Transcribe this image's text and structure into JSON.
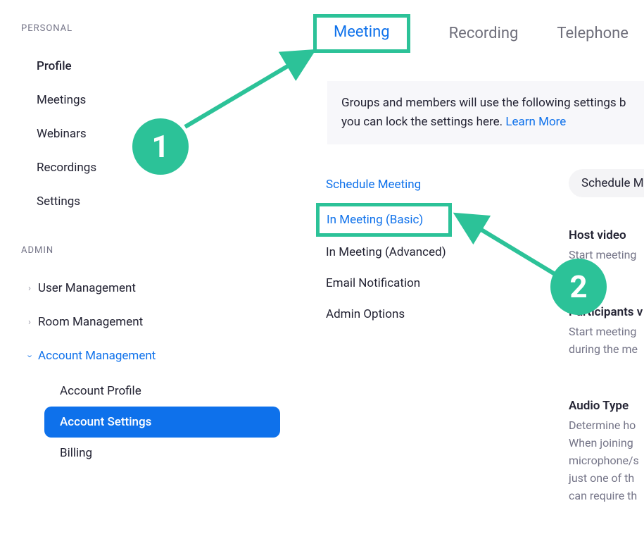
{
  "sidebar": {
    "personal_header": "PERSONAL",
    "personal_items": [
      "Profile",
      "Meetings",
      "Webinars",
      "Recordings",
      "Settings"
    ],
    "admin_header": "ADMIN",
    "admin_items": [
      {
        "label": "User Management",
        "expanded": false
      },
      {
        "label": "Room Management",
        "expanded": false
      },
      {
        "label": "Account Management",
        "expanded": true
      }
    ],
    "account_sub_items": [
      "Account Profile",
      "Account Settings",
      "Billing"
    ],
    "selected_sub": "Account Settings"
  },
  "tabs": {
    "items": [
      "Meeting",
      "Recording",
      "Telephone"
    ],
    "active": "Meeting"
  },
  "banner": {
    "text_before": "Groups and members will use the following settings b",
    "text_line2_before": "you can lock the settings here. ",
    "learn_more": "Learn More"
  },
  "subnav": {
    "items": [
      {
        "label": "Schedule Meeting",
        "link": true
      },
      {
        "label": "In Meeting (Basic)",
        "link": true,
        "boxed": true
      },
      {
        "label": "In Meeting (Advanced)",
        "link": false
      },
      {
        "label": "Email Notification",
        "link": false
      },
      {
        "label": "Admin Options",
        "link": false
      }
    ]
  },
  "right": {
    "pill": "Schedule Me",
    "settings": [
      {
        "title": "Host video",
        "desc": "Start meeting"
      },
      {
        "title": "Participants v",
        "desc": "Start meeting\nduring the me"
      },
      {
        "title": "Audio Type",
        "desc": "Determine ho\nWhen joining\nmicrophone/s\njust one of th\ncan require th"
      }
    ]
  },
  "annotations": {
    "step1": "1",
    "step2": "2"
  },
  "colors": {
    "accent": "#2cc298",
    "link": "#0E71EB"
  }
}
